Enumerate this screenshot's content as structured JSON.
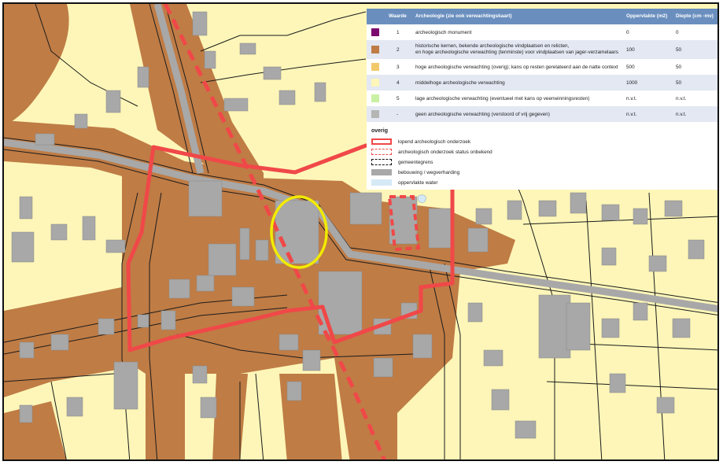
{
  "legend": {
    "header": {
      "value": "Waarde",
      "category": "Archeologie (zie ook verwachtingskaart)",
      "area": "Oppervlakte (m2)",
      "depth": "Diepte (cm -mv)"
    },
    "rows": [
      {
        "value": "1",
        "desc": "archeologisch monument",
        "desc2": "",
        "area": "0",
        "depth": "0",
        "color": "#7b0a6e"
      },
      {
        "value": "2",
        "desc": "historische kernen, bekende archeologische vindplaatsen en relicten,",
        "desc2": "en hoge archeologische verwachting (tenminste) voor vindplaatsen van jager-verzamelaars",
        "area": "100",
        "depth": "50",
        "color": "#bf7c45"
      },
      {
        "value": "3",
        "desc": "hoge archeologische verwachting (overig); kans op resten gerelateerd aan de natte context",
        "desc2": "",
        "area": "500",
        "depth": "50",
        "color": "#f2c96b"
      },
      {
        "value": "4",
        "desc": "middelhoge archeologische verwachting",
        "desc2": "",
        "area": "1000",
        "depth": "50",
        "color": "#fdf6b8"
      },
      {
        "value": "5",
        "desc": "lage archeologische verwachting (eventueel met kans op veenwinningsresten)",
        "desc2": "",
        "area": "n.v.t.",
        "depth": "n.v.t.",
        "color": "#c9f0a3"
      },
      {
        "value": "-",
        "desc": "geen archeologische verwachting (verstoord of vrij gegeven)",
        "desc2": "",
        "area": "n.v.t.",
        "depth": "n.v.t.",
        "color": "#b5b5b5"
      }
    ],
    "overig_title": "overig",
    "overig": [
      {
        "label": "lopend archeologisch onderzoek",
        "style": "solid-red"
      },
      {
        "label": "archeologisch onderzoek status onbekend",
        "style": "dashed-red"
      },
      {
        "label": "gemeentegrens",
        "style": "dashed-black"
      },
      {
        "label": "bebouwing / wegverharding",
        "style": "grey-fill"
      },
      {
        "label": "oppervlakte water",
        "style": "water-fill"
      }
    ]
  },
  "colors": {
    "historic_core": "#bf7c45",
    "background": "#fdf6b8",
    "buildings": "#a8a8a8",
    "research_line": "#f04848",
    "highlight": "#f2ea00",
    "legend_header": "#6a8fbf"
  }
}
